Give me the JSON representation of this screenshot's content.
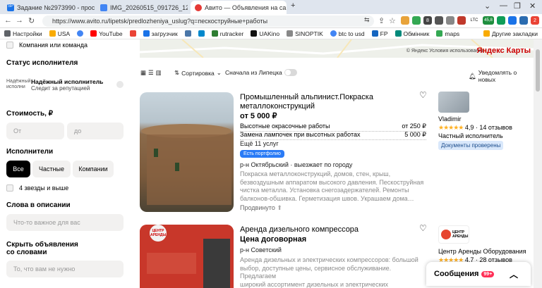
{
  "browser": {
    "tabs": [
      {
        "title": "Задание №2973990 - просмотр з…",
        "color": "#1a73e8"
      },
      {
        "title": "IMG_20260515_091726_120.jpg - …",
        "color": "#4285f4"
      },
      {
        "title": "Авито — Объявления на сайте А…",
        "color": "#e53935"
      }
    ],
    "url": "https://www.avito.ru/lipetsk/predlozheniya_uslug?q=пескоструйные+работы",
    "ext_badges": {
      "count1": "8",
      "ltc": "LTC",
      "ltc_val": "45,8",
      "mail": "2"
    },
    "bookmarks": [
      "Настройки",
      "USA",
      "",
      "YouTube",
      "",
      "загрузчик",
      "",
      "",
      "rutracker",
      "UAKino",
      "SINOPTIK",
      "btc to usd",
      "FP",
      "Обмінник",
      "maps",
      "Другие закладки"
    ]
  },
  "filters": {
    "company_label": "Компания или команда",
    "status_heading": "Статус исполнителя",
    "reliable_title": "Надёжный исполнитель",
    "reliable_sub": "Следит за репутацией",
    "reliable_img_alt": "Надёжный исполни",
    "cost_heading": "Стоимость, ₽",
    "from_placeholder": "От",
    "to_placeholder": "до",
    "performers_heading": "Исполнители",
    "performer_options": [
      "Все",
      "Частные",
      "Компании"
    ],
    "rating_label": "4 звезды и выше",
    "words_heading": "Слова в описании",
    "words_placeholder": "Что-то важное для вас",
    "hide_heading_1": "Скрыть объявления",
    "hide_heading_2": "со словами",
    "hide_placeholder": "То, что вам не нужно"
  },
  "map": {
    "copyright": "© Яндекс Условия использования",
    "logo": "Яндекс Карты"
  },
  "toolbar": {
    "sort_label": "Сортировка",
    "lipetsk_label": "Сначала из Липецка",
    "notify_label": "Уведомлять о новых"
  },
  "listings": [
    {
      "title_1": "Промышленный альпинист.Покраска",
      "title_2": "металлоконструкций",
      "price": "от 5 000 ₽",
      "services": [
        {
          "name": "Высотные окрасочные работы",
          "price": "от 250 ₽"
        },
        {
          "name": "Замена лампочек при высотных работах",
          "price": "5 000 ₽"
        }
      ],
      "more": "Ещё 11 услуг",
      "badge": "Есть портфолио",
      "location": "р-н Октябрьский · выезжает по городу",
      "desc": [
        "Покраска металлоконструкций, домов, стен, крыш,",
        "безвоздушным аппаратом высокого давления. Пескоструйная",
        "чистка металла. Установка снегозадержателей. Ремонты",
        "балконов-обшивка. Герметизация швов. Украшаем дома…"
      ],
      "promoted": "Продвинуто",
      "seller": {
        "name": "Vladimir",
        "rating": "4,9",
        "reviews": "14 отзывов",
        "type": "Частный исполнитель",
        "verified": "Документы проверены"
      }
    },
    {
      "title_1": "Аренда дизельного компрессора",
      "price": "Цена договорная",
      "location": "р-н Советский",
      "desc": [
        "Аренда дизельных и электрических компрессоров: большой",
        "выбор, доступные цены, сервисное обслуживание. Предлагаем",
        "широкий ассортимент дизельных и электрических"
      ],
      "photo_text": "ЦЕНТР АРЕНДЫ",
      "seller": {
        "name": "Центр Аренды Оборудования",
        "rating": "4,7",
        "reviews": "28 отзывов",
        "logo_text": "ЦЕНТР АРЕНДЫ"
      }
    }
  ],
  "messages": {
    "label": "Сообщения",
    "count": "99+"
  }
}
